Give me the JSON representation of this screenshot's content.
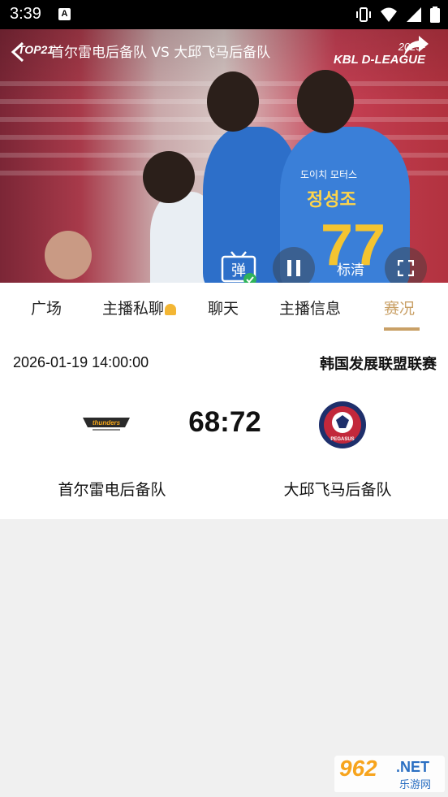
{
  "status_bar": {
    "time": "3:39",
    "a_badge": "A",
    "icons": [
      "vibrate-icon",
      "wifi-icon",
      "signal-icon",
      "battery-icon"
    ]
  },
  "video": {
    "logo_text": "TOP21",
    "title": "首尔雷电后备队 VS 大邱飞马后备队",
    "league_year": "2025-",
    "league_name": "KBL D-LEAGUE",
    "jersey_sponsor": "도이치 모터스",
    "jersey_name": "정성조",
    "jersey_number": "77",
    "danmaku_label": "弹",
    "quality_label": "标清",
    "accent_check": "#2fb35a"
  },
  "tabs": [
    {
      "label": "广场"
    },
    {
      "label": "主播私聊"
    },
    {
      "label": "聊天"
    },
    {
      "label": "主播信息"
    },
    {
      "label": "赛况"
    }
  ],
  "active_tab_color": "#c9a066",
  "match": {
    "datetime": "2026-01-19 14:00:00",
    "league": "韩国发展联盟联赛",
    "home_score": "68",
    "away_score": "72",
    "separator": ":",
    "home_team": "首尔雷电后备队",
    "away_team": "大邱飞马后备队",
    "home_logo_text": "thunders",
    "away_logo_text": "PEGASUS"
  },
  "watermark": {
    "big": "962",
    "net": ".NET",
    "sub": "乐游网"
  }
}
